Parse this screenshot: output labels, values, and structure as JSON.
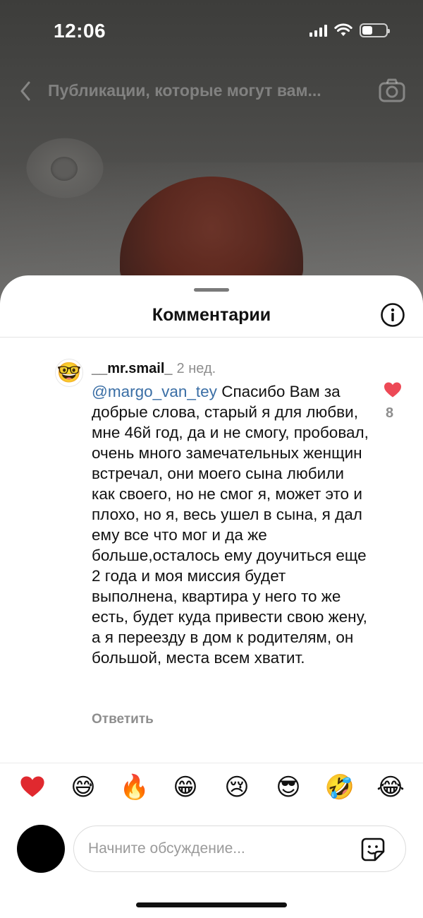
{
  "status_bar": {
    "time": "12:06",
    "battery_level": 0.45
  },
  "top_nav": {
    "title": "Публикации, которые могут вам..."
  },
  "sheet": {
    "title": "Комментарии"
  },
  "comment": {
    "username": "__mr.smail_",
    "time_ago": "2 нед.",
    "mention": "@margo_van_tey",
    "text": " Спасибо Вам за добрые слова, старый я для любви, мне 46й год, да и не смогу, пробовал, очень много замечательных женщин встречал, они моего сына любили как своего, но не смог я, может это и плохо, но я, весь ушел в сына, я дал ему все что мог и да же больше,осталось ему доучиться еще 2 года и моя миссия будет выполнена, квартира у него то же есть, будет куда привести свою жену, а я переезду в дом к родителям, он большой, места всем хватит.",
    "likes": "8",
    "reply_label": "Ответить",
    "like_color": "#ed4956",
    "mention_color": "#3a6ea5"
  },
  "emoji_bar": [
    "❤️",
    "😅",
    "🔥",
    "😁",
    "😢",
    "😎",
    "🤣",
    "😂"
  ],
  "composer": {
    "placeholder": "Начните обсуждение..."
  }
}
